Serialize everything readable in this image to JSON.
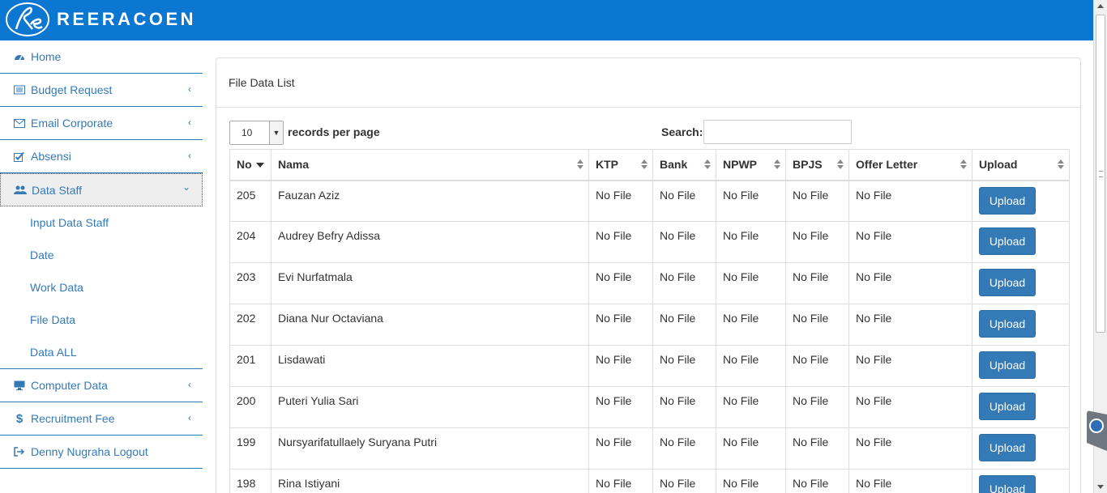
{
  "brand": {
    "name": "REERACOEN"
  },
  "sidebar": {
    "items": [
      {
        "label": "Home",
        "icon": "dashboard-icon"
      },
      {
        "label": "Budget Request",
        "icon": "list-icon"
      },
      {
        "label": "Email Corporate",
        "icon": "envelope-icon"
      },
      {
        "label": "Absensi",
        "icon": "checkbox-icon"
      },
      {
        "label": "Data Staff",
        "icon": "users-icon"
      },
      {
        "label": "Computer Data",
        "icon": "monitor-icon"
      },
      {
        "label": "Recruitment Fee",
        "icon": "dollar-icon"
      },
      {
        "label": "Denny Nugraha Logout",
        "icon": "logout-icon"
      }
    ],
    "sub_items": [
      {
        "label": "Input Data Staff"
      },
      {
        "label": "Date"
      },
      {
        "label": "Work Data"
      },
      {
        "label": "File Data"
      },
      {
        "label": "Data ALL"
      }
    ]
  },
  "panel": {
    "title": "File Data List"
  },
  "controls": {
    "page_length": "10",
    "page_length_label": "records per page",
    "search_label": "Search:",
    "search_value": ""
  },
  "table": {
    "headers": [
      "No",
      "Nama",
      "KTP",
      "Bank",
      "NPWP",
      "BPJS",
      "Offer Letter",
      "Upload"
    ],
    "upload_label": "Upload",
    "rows": [
      {
        "no": "205",
        "nama": "Fauzan Aziz",
        "ktp": "No File",
        "bank": "No File",
        "npwp": "No File",
        "bpjs": "No File",
        "offer": "No File"
      },
      {
        "no": "204",
        "nama": "Audrey Befry Adissa",
        "ktp": "No File",
        "bank": "No File",
        "npwp": "No File",
        "bpjs": "No File",
        "offer": "No File"
      },
      {
        "no": "203",
        "nama": "Evi Nurfatmala",
        "ktp": "No File",
        "bank": "No File",
        "npwp": "No File",
        "bpjs": "No File",
        "offer": "No File"
      },
      {
        "no": "202",
        "nama": "Diana Nur Octaviana",
        "ktp": "No File",
        "bank": "No File",
        "npwp": "No File",
        "bpjs": "No File",
        "offer": "No File"
      },
      {
        "no": "201",
        "nama": "Lisdawati",
        "ktp": "No File",
        "bank": "No File",
        "npwp": "No File",
        "bpjs": "No File",
        "offer": "No File"
      },
      {
        "no": "200",
        "nama": "Puteri Yulia Sari",
        "ktp": "No File",
        "bank": "No File",
        "npwp": "No File",
        "bpjs": "No File",
        "offer": "No File"
      },
      {
        "no": "199",
        "nama": "Nursyarifatullaely Suryana Putri",
        "ktp": "No File",
        "bank": "No File",
        "npwp": "No File",
        "bpjs": "No File",
        "offer": "No File"
      },
      {
        "no": "198",
        "nama": "Rina Istiyani",
        "ktp": "No File",
        "bank": "No File",
        "npwp": "No File",
        "bpjs": "No File",
        "offer": "No File"
      }
    ]
  },
  "colors": {
    "navbar": "#0b77d0",
    "link": "#337ab7",
    "button": "#337ab7"
  }
}
